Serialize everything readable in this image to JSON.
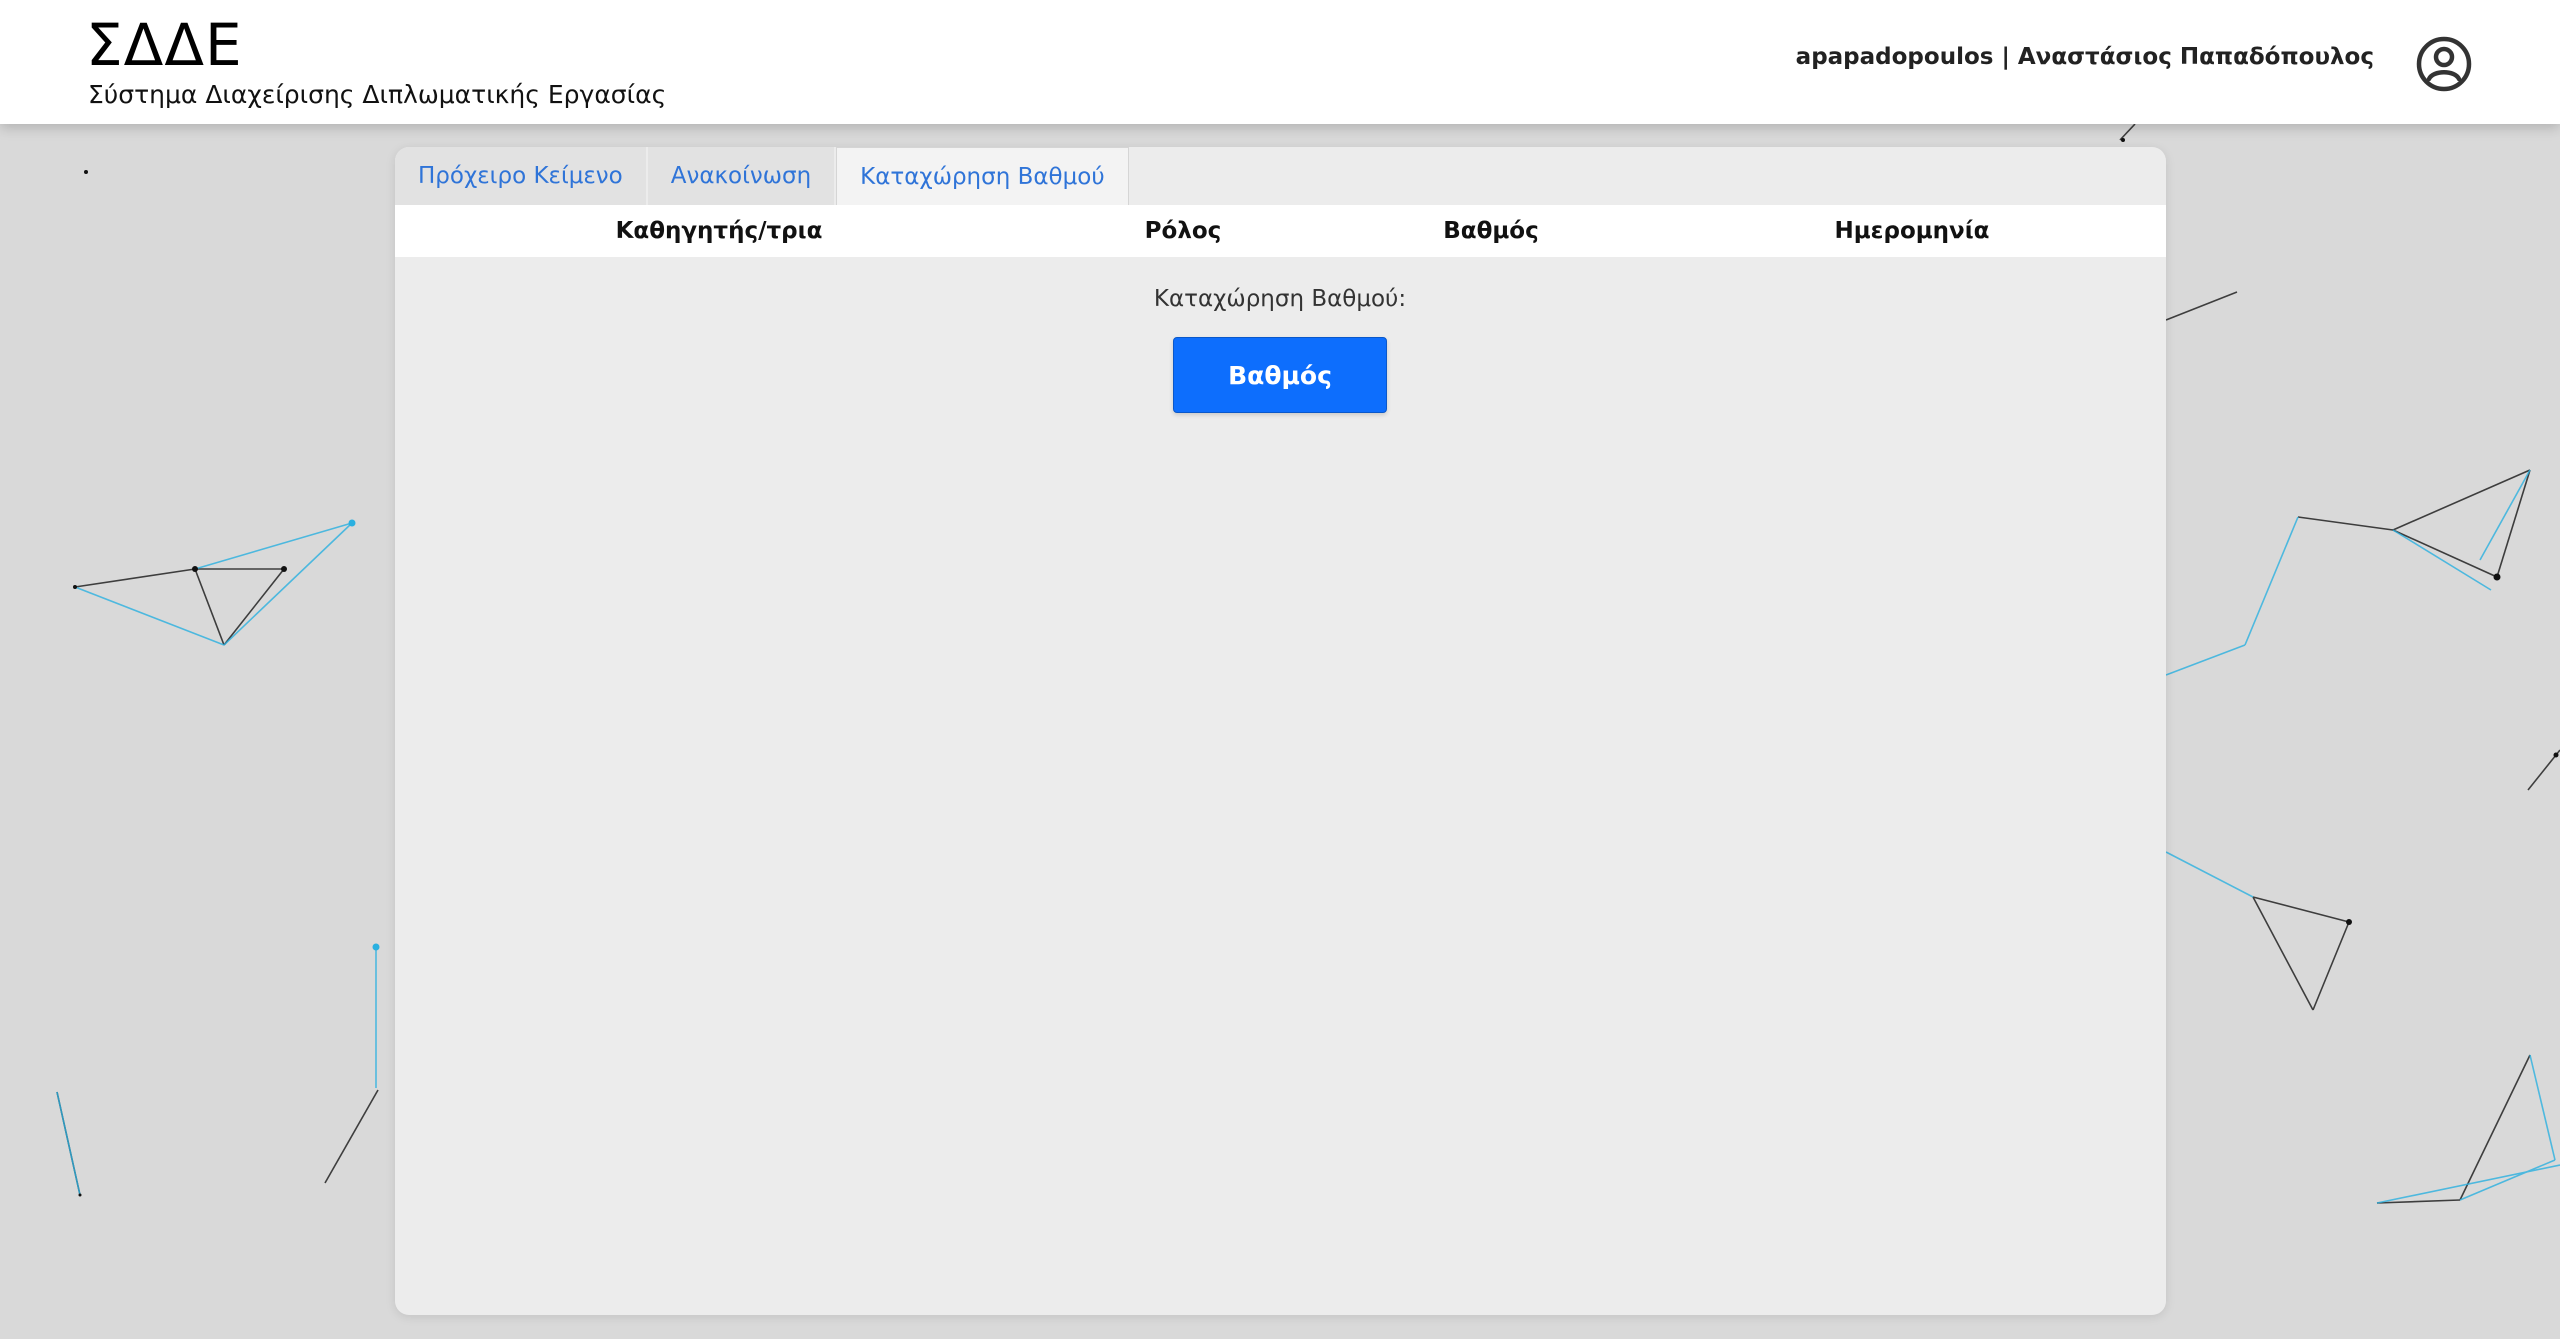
{
  "header": {
    "logo": "ΣΔΔΕ",
    "subtitle": "Σύστημα Διαχείρισης Διπλωματικής Εργασίας",
    "user_display": "apapadopoulos | Αναστάσιος Παπαδόπουλος",
    "user_icon": "user-circle-icon"
  },
  "tabs": [
    {
      "label": "Πρόχειρο Κείμενο",
      "active": false
    },
    {
      "label": "Ανακοίνωση",
      "active": false
    },
    {
      "label": "Καταχώρηση Βαθμού",
      "active": true
    }
  ],
  "table": {
    "columns": [
      "Καθηγητής/τρια",
      "Ρόλος",
      "Βαθμός",
      "Ημερομηνία"
    ]
  },
  "grade_entry": {
    "label": "Καταχώρηση Βαθμού:",
    "button_label": "Βαθμός"
  },
  "colors": {
    "accent": "#0d6efd",
    "tab_link": "#2f74d8",
    "background": "#d9d9d9",
    "network_dark": "#222222",
    "network_blue": "#2ab0e0"
  }
}
